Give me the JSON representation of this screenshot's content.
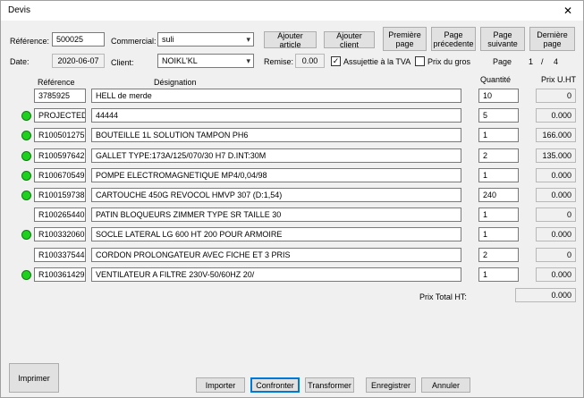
{
  "window": {
    "title": "Devis",
    "close_glyph": "✕"
  },
  "header": {
    "reference_label": "Référence:",
    "reference_value": "500025",
    "commercial_label": "Commercial:",
    "commercial_value": "suli",
    "date_label": "Date:",
    "date_value": "2020-06-07",
    "client_label": "Client:",
    "client_value": "NOIKL'KL",
    "remise_label": "Remise:",
    "remise_value": "0.00",
    "tva_label": "Assujettie à la TVA",
    "tva_checked": true,
    "prix_gros_label": "Prix du gros",
    "prix_gros_checked": false,
    "page_label": "Page",
    "page_current": "1",
    "page_separator": "/",
    "page_total": "4"
  },
  "buttons": {
    "ajouter_article": "Ajouter article",
    "ajouter_client": "Ajouter client",
    "premiere_page": "Première page",
    "page_precedente": "Page précedente",
    "page_suivante": "Page suivante",
    "derniere_page": "Dernière page",
    "imprimer": "Imprimer",
    "importer": "Importer",
    "confronter": "Confronter",
    "transformer": "Transformer",
    "enregistrer": "Enregistrer",
    "annuler": "Annuler"
  },
  "table": {
    "columns": {
      "reference": "Référence",
      "designation": "Désignation",
      "quantite": "Quantité",
      "prix": "Prix U.HT"
    },
    "rows": [
      {
        "status": false,
        "ref": "3785925",
        "designation": "HELL de merde",
        "qty": "10",
        "price": "0"
      },
      {
        "status": true,
        "ref": "PROJECTED",
        "designation": "44444",
        "qty": "5",
        "price": "0.000"
      },
      {
        "status": true,
        "ref": "R100501275",
        "designation": "BOUTEILLE 1L SOLUTION TAMPON PH6",
        "qty": "1",
        "price": "166.000"
      },
      {
        "status": true,
        "ref": "R100597642",
        "designation": "GALLET TYPE:173A/125/070/30 H7 D.INT:30M",
        "qty": "2",
        "price": "135.000"
      },
      {
        "status": true,
        "ref": "R100670549",
        "designation": "POMPE ELECTROMAGNETIQUE MP4/0,04/98",
        "qty": "1",
        "price": "0.000"
      },
      {
        "status": true,
        "ref": "R100159738",
        "designation": "CARTOUCHE 450G REVOCOL HMVP 307 (D:1,54)",
        "qty": "240",
        "price": "0.000"
      },
      {
        "status": false,
        "ref": "R100265440",
        "designation": "PATIN BLOQUEURS ZIMMER TYPE SR TAILLE 30",
        "qty": "1",
        "price": "0"
      },
      {
        "status": true,
        "ref": "R100332060",
        "designation": "SOCLE LATERAL LG 600 HT 200 POUR ARMOIRE",
        "qty": "1",
        "price": "0.000"
      },
      {
        "status": false,
        "ref": "R100337544",
        "designation": "CORDON PROLONGATEUR AVEC FICHE ET 3 PRIS",
        "qty": "2",
        "price": "0"
      },
      {
        "status": true,
        "ref": "R100361429",
        "designation": "VENTILATEUR A FILTRE  230V-50/60HZ  20/",
        "qty": "1",
        "price": "0.000"
      }
    ]
  },
  "total": {
    "label": "Prix Total HT:",
    "value": "0.000"
  },
  "colors": {
    "status_ok": "#1fd11f",
    "focus": "#0078d7"
  }
}
